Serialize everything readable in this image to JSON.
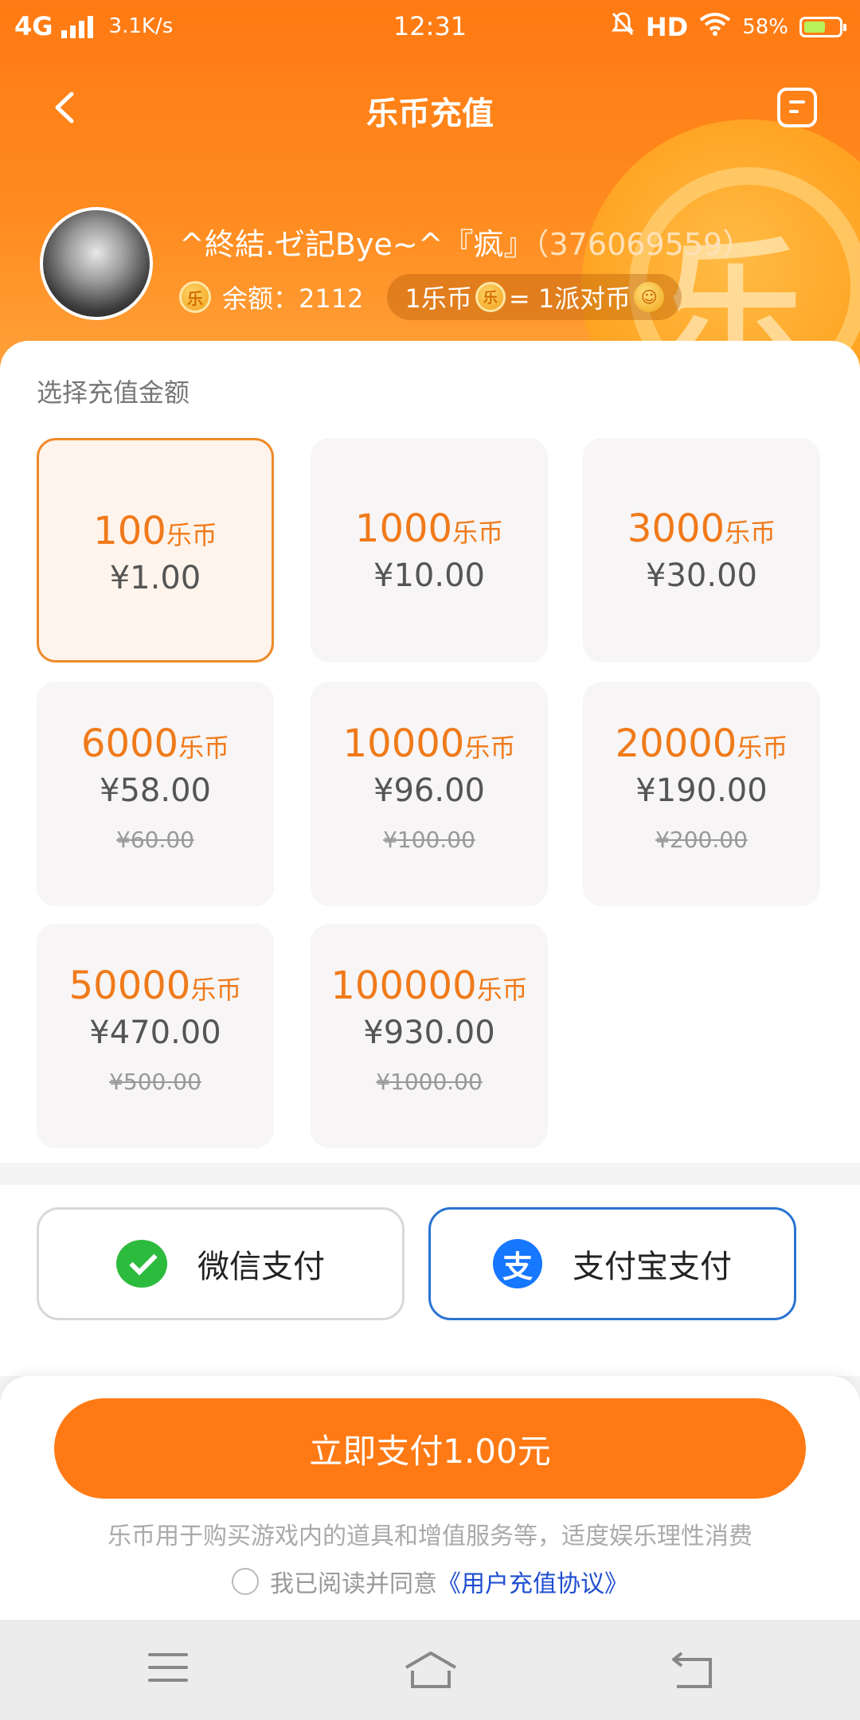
{
  "status_bar": {
    "network": "4G",
    "speed": "3.1K/s",
    "time": "12:31",
    "hd": "HD",
    "battery": "58%"
  },
  "nav": {
    "title": "乐币充值"
  },
  "profile": {
    "username": "^終結.ゼ記Bye~^『疯』",
    "uid": "（376069559）",
    "balance_label": "余额：2112",
    "rate_left": "1乐币",
    "rate_right": "= 1派对币",
    "coin_glyph": "乐"
  },
  "recharge": {
    "section_label": "选择充值金额",
    "unit": "乐币",
    "options": [
      {
        "coins": "100",
        "price": "¥1.00",
        "original": ""
      },
      {
        "coins": "1000",
        "price": "¥10.00",
        "original": ""
      },
      {
        "coins": "3000",
        "price": "¥30.00",
        "original": ""
      },
      {
        "coins": "6000",
        "price": "¥58.00",
        "original": "¥60.00"
      },
      {
        "coins": "10000",
        "price": "¥96.00",
        "original": "¥100.00"
      },
      {
        "coins": "20000",
        "price": "¥190.00",
        "original": "¥200.00"
      },
      {
        "coins": "50000",
        "price": "¥470.00",
        "original": "¥500.00"
      },
      {
        "coins": "100000",
        "price": "¥930.00",
        "original": "¥1000.00"
      }
    ]
  },
  "payment": {
    "wechat_label": "微信支付",
    "alipay_label": "支付宝支付",
    "alipay_glyph": "支"
  },
  "footer": {
    "pay_button": "立即支付1.00元",
    "notice": "乐币用于购买游戏内的道具和增值服务等，适度娱乐理性消费",
    "agree_text": "我已阅读并同意",
    "agreement_link": "《用户充值协议》"
  },
  "colors": {
    "accent": "#ff7a14",
    "selected_border": "#f08a2a",
    "alipay_border": "#2a74d2",
    "link": "#1f4fd1"
  }
}
